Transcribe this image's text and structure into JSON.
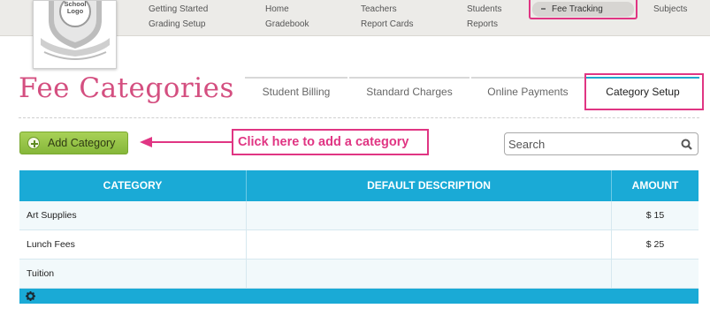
{
  "nav": {
    "row1": [
      "Getting Started",
      "Home",
      "Teachers",
      "Students",
      "Fee Tracking",
      "Subjects"
    ],
    "row2": [
      "Grading Setup",
      "Gradebook",
      "Report Cards",
      "Reports"
    ]
  },
  "logo": {
    "text": "School Logo"
  },
  "page": {
    "title": "Fee Categories"
  },
  "tabs": [
    "Student Billing",
    "Standard Charges",
    "Online Payments",
    "Category Setup"
  ],
  "toolbar": {
    "add_label": "Add Category",
    "callout": "Click here to add a category",
    "search_placeholder": "Search"
  },
  "table": {
    "headers": [
      "CATEGORY",
      "DEFAULT DESCRIPTION",
      "AMOUNT"
    ],
    "rows": [
      [
        "Art Supplies",
        "",
        "$ 15"
      ],
      [
        "Lunch Fees",
        "",
        "$ 25"
      ],
      [
        "Tuition",
        "",
        ""
      ]
    ]
  },
  "colors": {
    "accent_pink": "#e03583",
    "title_pink": "#d44f80",
    "table_blue": "#1aaad6",
    "button_green": "#96c449"
  }
}
